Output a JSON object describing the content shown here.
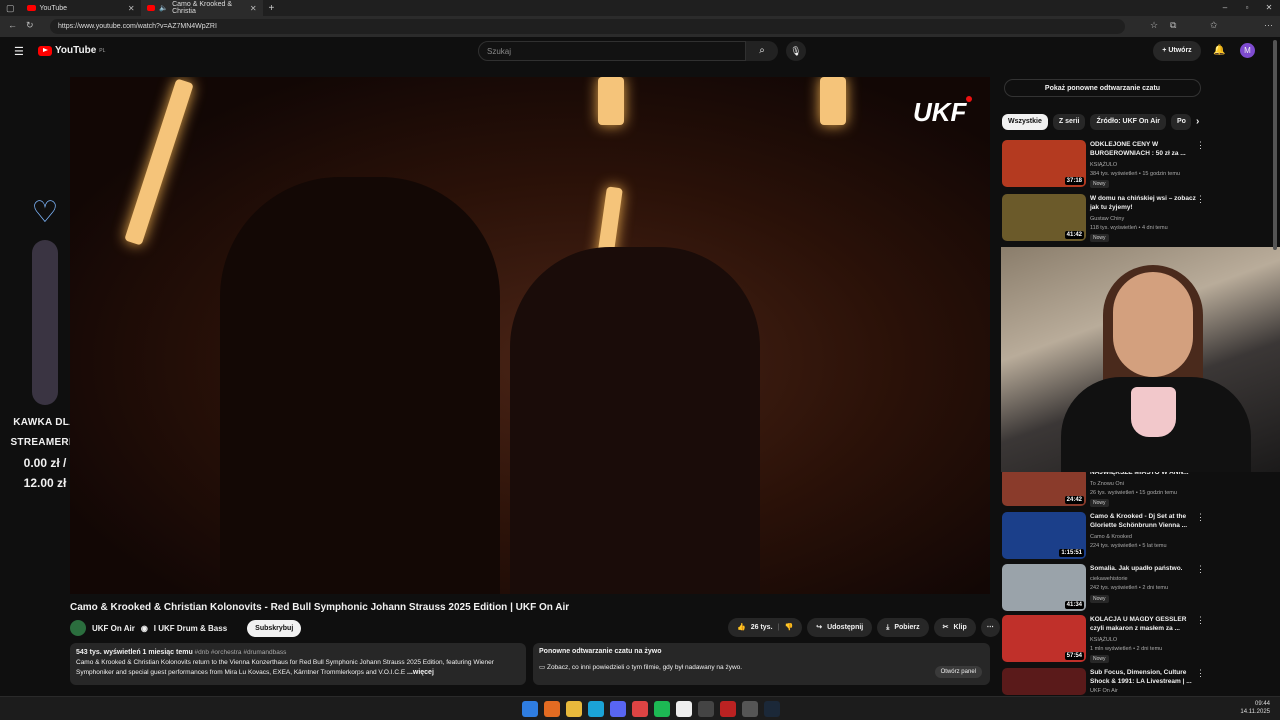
{
  "browser": {
    "tabs": [
      {
        "label": "YouTube"
      },
      {
        "label": "Camo & Krooked & Christia"
      }
    ],
    "url": "https://www.youtube.com/watch?v=AZ7MN4WpZRI"
  },
  "yt": {
    "logo": "YouTube",
    "region": "PL",
    "search_placeholder": "Szukaj",
    "create_label": "Utwórz",
    "avatar_letter": "M"
  },
  "overlay": {
    "ukf_logo": "UKF",
    "widget_line1": "KAWKA DLA",
    "widget_line2": "STREAMERKI",
    "widget_val1": "0.00 zł /",
    "widget_val2": "12.00 zł"
  },
  "video": {
    "title": "Camo & Krooked & Christian Kolonovits - Red Bull Symphonic Johann Strauss 2025 Edition | UKF On Air",
    "channel": "UKF On Air",
    "channel_extra": "I UKF Drum & Bass",
    "subscribe": "Subskrybuj",
    "likes": "26 tys.",
    "share": "Udostępnij",
    "download": "Pobierz",
    "clip": "Klip",
    "desc_stats": "543 tys. wyświetleń  1 miesiąc temu",
    "desc_tags": "#dnb #orchestra #drumandbass",
    "desc_text": "Camo & Krooked & Christian Kolonovits return to the Vienna Konzerthaus for Red Bull Symphonic Johann Strauss 2025 Edition, featuring Wiener Symphoniker and special guest performances from Mira Lu Kovacs, EXEA, Kärntner Trommlerkorps and V.O.I.C.E",
    "desc_more": "...więcej",
    "chat_title": "Ponowne odtwarzanie czatu na żywo",
    "chat_text": "Zobacz, co inni powiedzieli o tym filmie, gdy był nadawany na żywo.",
    "chat_btn": "Otwórz panel"
  },
  "sidebar": {
    "show_chat": "Pokaż ponowne odtwarzanie czatu",
    "chips": [
      "Wszystkie",
      "Z serii",
      "Źródło: UKF On Air",
      "Po"
    ],
    "recs": [
      {
        "title": "ODKLEJONE CENY W BURGEROWNIACH : 50 zł za ...",
        "channel": "KSIĄŻULO",
        "meta": "384 tys. wyświetleń • 15 godzin temu",
        "dur": "37:18",
        "new": "Nowy",
        "color": "#b43a20"
      },
      {
        "title": "W domu na chińskiej wsi – zobacz jak tu żyjemy!",
        "channel": "Gustaw Chiny",
        "meta": "118 tys. wyświetleń • 4 dni temu",
        "dur": "41:42",
        "new": "Nowy",
        "color": "#6b5a2a"
      },
      {
        "title": "NAJWIĘKSZE MIASTO W ANN...",
        "channel": "To Znowu Oni",
        "meta": "26 tys. wyświetleń • 15 godzin temu",
        "dur": "24:42",
        "new": "Nowy",
        "color": "#8a3b2b"
      },
      {
        "title": "Camo & Krooked - Dj Set at the Gloriette Schönbrunn Vienna ...",
        "channel": "Camo & Krooked",
        "meta": "224 tys. wyświetleń • 5 lat temu",
        "dur": "1:15:51",
        "new": "",
        "color": "#1b3f8a"
      },
      {
        "title": "Somalia. Jak upadło państwo.",
        "channel": "ciekawehistorie",
        "meta": "242 tys. wyświetleń • 2 dni temu",
        "dur": "41:34",
        "new": "Nowy",
        "color": "#9aa3aa"
      },
      {
        "title": "KOLACJA U MAGDY GESSLER czyli makaron z masłem za ...",
        "channel": "KSIĄŻULO",
        "meta": "1 mln wyświetleń • 2 dni temu",
        "dur": "57:54",
        "new": "Nowy",
        "color": "#c0302a"
      },
      {
        "title": "Sub Focus, Dimension, Culture Shock & 1991: LA Livestream | ...",
        "channel": "UKF On Air",
        "meta": "",
        "dur": "",
        "new": "",
        "color": "#5a1a1a"
      }
    ]
  },
  "taskbar": {
    "time": "09:44",
    "date": "14.11.2025"
  }
}
